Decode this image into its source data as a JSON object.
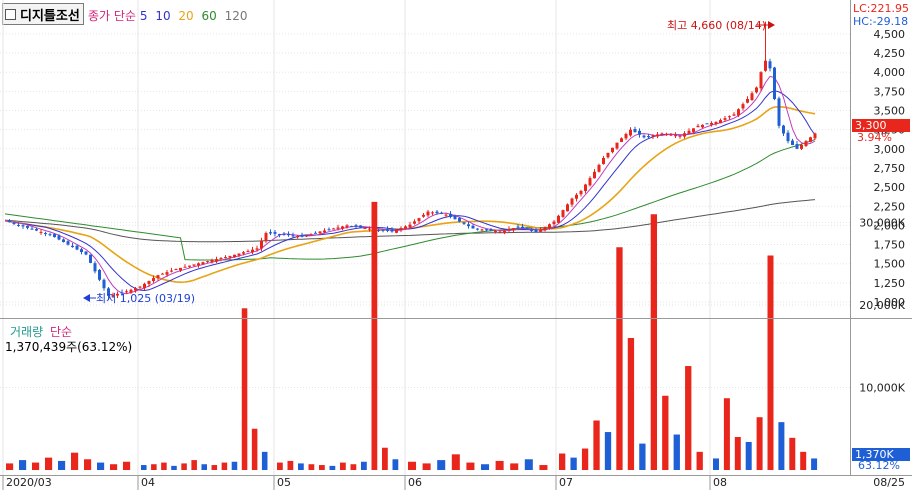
{
  "stock": {
    "name": "디지틀조선"
  },
  "price_legend": {
    "type": "종가",
    "method": "단순",
    "ma": [
      {
        "label": "5",
        "color": "#3333cc"
      },
      {
        "label": "10",
        "color": "#3333cc"
      },
      {
        "label": "20",
        "color": "#e8a317"
      },
      {
        "label": "60",
        "color": "#2e8b2e"
      },
      {
        "label": "120",
        "color": "#555555"
      }
    ]
  },
  "volume_legend": {
    "label": "거래량",
    "method": "단순",
    "value": "1,370,439주(63.12%)"
  },
  "indicators": {
    "lc": "LC:221.95",
    "hc": "HC:-29.18"
  },
  "annotations": {
    "high": "최고 4,660 (08/14)",
    "low": "최저 1,025 (03/19)"
  },
  "price_axis": {
    "ticks": [
      "4,500",
      "4,250",
      "4,000",
      "3,750",
      "3,500",
      "3,250",
      "3,000",
      "2,750",
      "2,500",
      "2,250",
      "2,000",
      "1,750",
      "1,500",
      "1,250",
      "1,000"
    ],
    "current_price": "3,300",
    "current_change": "3.94%"
  },
  "volume_axis": {
    "ticks": [
      "30,000K",
      "20,000K",
      "10,000K"
    ],
    "current_volume": "1,370K",
    "current_pct": "63.12%"
  },
  "date_axis": {
    "labels": [
      "2020/03",
      "04",
      "05",
      "06",
      "07",
      "08"
    ],
    "right_label": "08/25"
  },
  "colors": {
    "up": "#e8261c",
    "down": "#1f5fd6",
    "ma5": "#3333cc",
    "ma20": "#e8a317",
    "ma60": "#2e8b2e",
    "ma120": "#555555"
  },
  "chart_data": {
    "type": "candlestick",
    "price_range": [
      1000,
      4600
    ],
    "volume_range_k": [
      0,
      33000
    ],
    "highlights": {
      "high": 4660,
      "low": 1025,
      "last_close": 3300
    },
    "volume": [
      {
        "month": "03",
        "approx_k": [
          800,
          1200,
          900,
          1500,
          1100,
          2100,
          1300,
          900,
          700,
          1000
        ]
      },
      {
        "month": "04",
        "approx_k": [
          600,
          700,
          900,
          500,
          800,
          1200,
          700,
          600,
          900,
          1000,
          19600,
          5000,
          2200
        ]
      },
      {
        "month": "05",
        "approx_k": [
          900,
          1100,
          800,
          700,
          600,
          500,
          900,
          700,
          1000,
          32500,
          2700,
          1300
        ]
      },
      {
        "month": "06",
        "approx_k": [
          1000,
          800,
          1200,
          1900,
          900,
          700,
          1100,
          800,
          1300,
          600
        ]
      },
      {
        "month": "07",
        "approx_k": [
          2000,
          1500,
          2600,
          6000,
          4600,
          27000,
          16000,
          3200,
          31000,
          9000,
          4300,
          12600,
          2200
        ]
      },
      {
        "month": "08",
        "approx_k": [
          1400,
          8700,
          4000,
          3400,
          6400,
          26000,
          5800,
          3900,
          2200,
          1400
        ]
      }
    ]
  }
}
